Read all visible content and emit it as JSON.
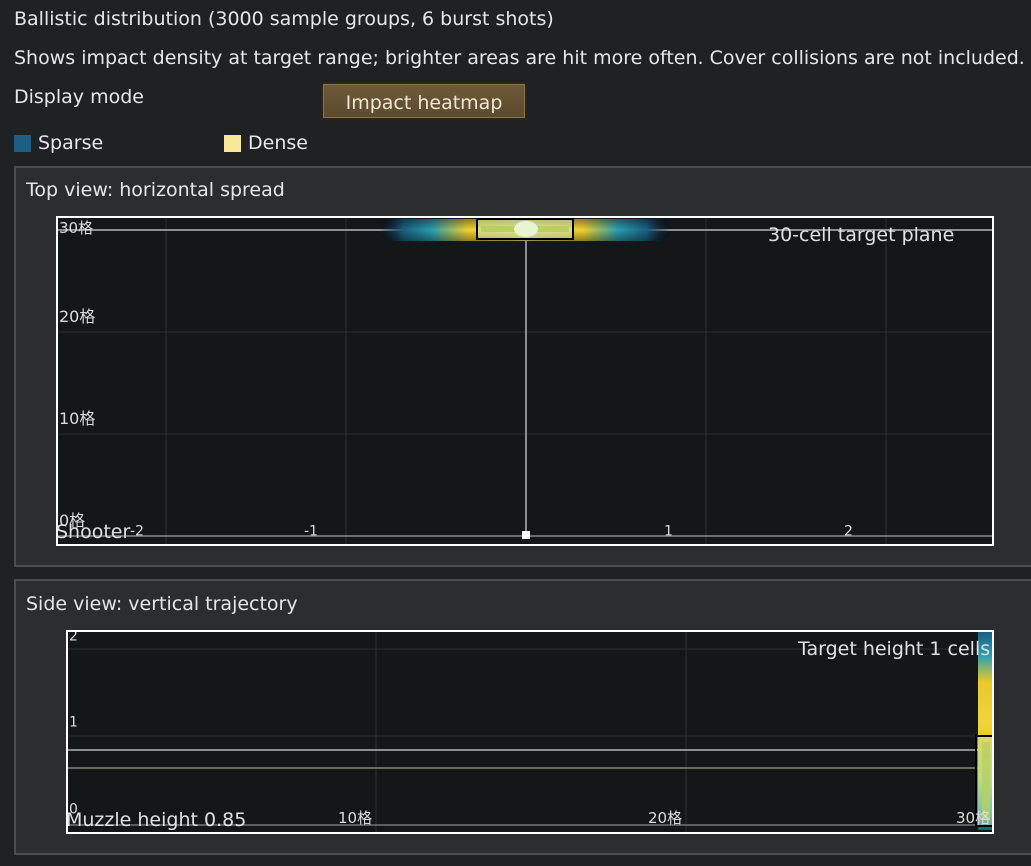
{
  "header": {
    "title": "Ballistic distribution (3000 sample groups, 6 burst shots)",
    "description": "Shows impact density at target range; brighter areas are hit more often. Cover collisions are not included.",
    "display_mode_label": "Display mode",
    "display_mode_value": "Impact heatmap"
  },
  "legend": {
    "sparse_label": "Sparse",
    "sparse_color": "#1b5f82",
    "dense_label": "Dense",
    "dense_color": "#fce89a"
  },
  "top_view": {
    "title": "Top view: horizontal spread",
    "target_label": "30-cell target plane",
    "shooter_label": "Shooter",
    "y_ticks": [
      "0格",
      "10格",
      "20格",
      "30格"
    ],
    "x_ticks": [
      "-2",
      "-1",
      "1",
      "2"
    ]
  },
  "side_view": {
    "title": "Side view: vertical trajectory",
    "target_label": "Target height 1 cells",
    "muzzle_label": "Muzzle height 0.85",
    "y_ticks": [
      "0",
      "1",
      "2"
    ],
    "x_ticks": [
      "10格",
      "20格",
      "30格"
    ]
  },
  "colors": {
    "background": "#1f2225",
    "panel": "#2b2d30",
    "plot": "#14171a",
    "button": "#6e5a3a"
  }
}
